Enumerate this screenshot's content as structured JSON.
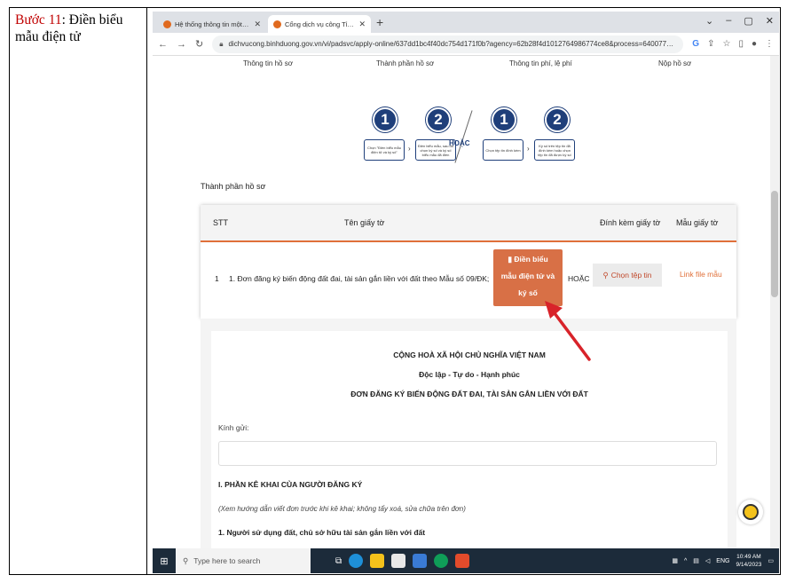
{
  "left_cell": {
    "step_label": "Bước 11",
    "step_text": ": Điền biểu mẫu điện tử"
  },
  "browser": {
    "tabs": [
      {
        "title": "Hệ thống thông tin một cửa điệ",
        "active": false
      },
      {
        "title": "Cổng dịch vụ công Tỉnh Bình Dư",
        "active": true
      }
    ],
    "new_tab": "+",
    "url": "dichvucong.binhduong.gov.vn/vi/padsvc/apply-online/637dd1bc4f40dc754d171f0b?agency=62b28f4d1012764986774ce8&process=640077b0949bd077f87aff6d&previous-pr..."
  },
  "steps_nav": [
    "Thông tin hồ sơ",
    "Thành phần hồ sơ",
    "Thông tin phí, lệ phí",
    "Nộp hồ sơ"
  ],
  "guide": {
    "numbers": [
      "1",
      "2",
      "1",
      "2"
    ],
    "boxes": [
      "Chọn \"Điền biểu mẫu điện tử và ký số\"",
      "Điền biểu mẫu, sau đó chọn ký số và ký số biểu mẫu đã điền",
      "Chọn tệp tin đính kèm",
      "Ký số trên tệp tin đã đính kèm hoặc chọn tệp tin đã được ký số"
    ],
    "or_label": "HOẶC"
  },
  "section_title": "Thành phần hồ sơ",
  "table": {
    "headers": {
      "stt": "STT",
      "name": "Tên giấy tờ",
      "attach": "Đính kèm giấy tờ",
      "sample": "Mẫu giấy tờ"
    },
    "row": {
      "stt": "1",
      "name": "1. Đơn đăng ký biến động đất đai, tài sản gắn liền với đất theo Mẫu số 09/ĐK;",
      "fill_button": [
        "Điền biểu",
        "mẫu điện tử và",
        "ký số"
      ],
      "or_label": "HOẶC",
      "choose_file": "Chọn tệp tin",
      "sample_link": "Link file mẫu"
    }
  },
  "form": {
    "header1": "CỘNG HOÀ XÃ HỘI CHỦ NGHĨA VIỆT NAM",
    "header2": "Độc lập - Tự do - Hạnh phúc",
    "header3": "ĐƠN ĐĂNG KÝ BIẾN ĐỘNG ĐẤT ĐAI, TÀI SẢN GẮN LIỀN VỚI ĐẤT",
    "kinh_gui": "Kính gửi:",
    "part1": "I. PHẦN KÊ KHAI CỦA NGƯỜI ĐĂNG KÝ",
    "note": "(Xem hướng dẫn viết đơn trước khi kê khai; không tẩy xoá, sửa chữa trên đơn)",
    "item1": "1. Người sử dụng đất, chủ sở hữu tài sản gắn liền với đất"
  },
  "taskbar": {
    "search_placeholder": "Type here to search",
    "lang": "ENG",
    "time": "10:49 AM",
    "date": "9/14/2023"
  },
  "colors": {
    "accent": "#d87046",
    "header_underline": "#e0703a",
    "guide_blue": "#1f3f7a",
    "arrow_red": "#d8232a"
  }
}
